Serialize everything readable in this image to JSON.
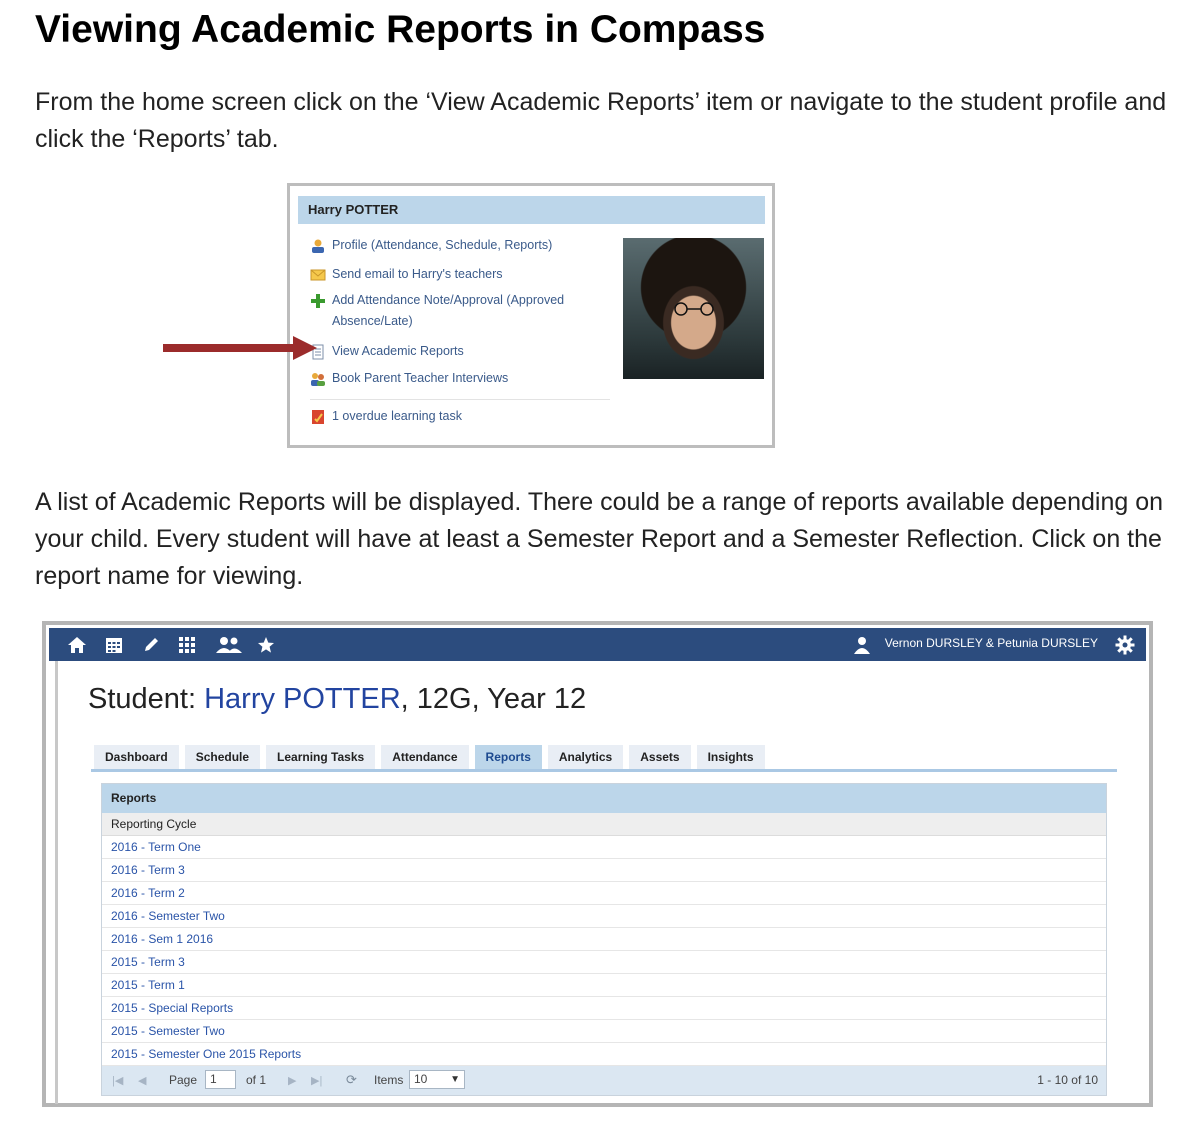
{
  "doc": {
    "title": "Viewing Academic Reports in Compass",
    "para1": "From the home screen click on the ‘View Academic Reports’ item or navigate to the student profile and click the ‘Reports’ tab.",
    "para2": "A list of Academic Reports will be displayed.  There could be a range of reports available depending on your child.  Every student will have at least a Semester Report and a Semester Reflection.  Click on the report name for viewing."
  },
  "card": {
    "name": "Harry POTTER",
    "items": [
      {
        "label": "Profile (Attendance, Schedule, Reports)",
        "icon": "person-icon"
      },
      {
        "label": "Send email to Harry's teachers",
        "icon": "envelope-icon"
      },
      {
        "label": "Add Attendance Note/Approval (Approved Absence/Late)",
        "icon": "plus-icon"
      },
      {
        "label": "View Academic Reports",
        "icon": "report-icon"
      },
      {
        "label": "Book Parent Teacher Interviews",
        "icon": "people-icon"
      },
      {
        "label": "1 overdue learning task",
        "icon": "task-icon"
      }
    ]
  },
  "app": {
    "user": "Vernon DURSLEY & Petunia DURSLEY",
    "student_prefix": "Student: ",
    "student_name": "Harry POTTER",
    "student_suffix": ", 12G, Year 12",
    "tabs": [
      "Dashboard",
      "Schedule",
      "Learning Tasks",
      "Attendance",
      "Reports",
      "Analytics",
      "Assets",
      "Insights"
    ],
    "active_tab": "Reports",
    "grid_title": "Reports",
    "column_header": "Reporting Cycle",
    "rows": [
      "2016 - Term One",
      "2016 - Term 3",
      "2016 - Term 2",
      "2016 - Semester Two",
      "2016 - Sem 1 2016",
      "2015 - Term 3",
      "2015 - Term 1",
      "2015 - Special Reports",
      "2015 - Semester Two",
      "2015 - Semester One 2015 Reports"
    ],
    "pager": {
      "page_label": "Page",
      "page_value": "1",
      "of_label": "of 1",
      "items_label": "Items",
      "items_value": "10",
      "range": "1 - 10 of 10"
    }
  },
  "colors": {
    "topbar": "#2c4c7e",
    "header_blue": "#bcd6ea",
    "link_blue": "#2a54a8",
    "arrow_red": "#9b2b2b"
  }
}
